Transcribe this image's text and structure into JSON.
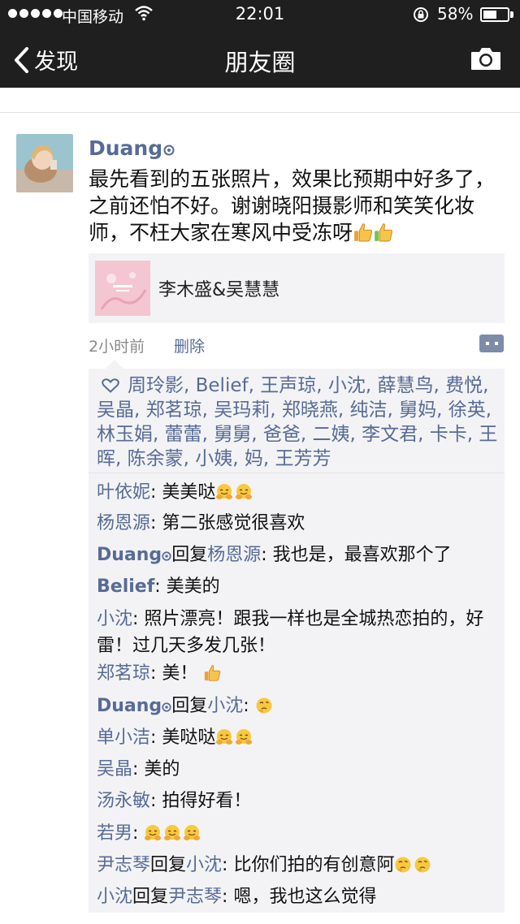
{
  "status_bar": {
    "carrier": "中国移动",
    "time": "22:01",
    "battery_percent_text": "58%",
    "battery_level": 0.58
  },
  "nav": {
    "back_label": "发现",
    "title": "朋友圈",
    "camera_icon": "camera-icon"
  },
  "post": {
    "author": "Duang",
    "text": "最先看到的五张照片，效果比预期中好多了，之前还怕不好。谢谢晓阳摄影师和笑笑化妆师，不枉大家在寒风中受冻呀",
    "link_title": "李木盛&吴慧慧",
    "time": "2小时前",
    "delete_label": "删除"
  },
  "likes": "周玲影, Belief, 王声琼, 小沈, 薛慧鸟, 费悦, 吴晶, 郑茗琼, 吴玛莉, 郑晓燕, 纯洁, 舅妈, 徐英, 林玉娟, 蕾蕾, 舅舅, 爸爸, 二姨, 李文君, 卡卡, 王晖, 陈余蒙, 小姨, 妈, 王芳芳",
  "comments": [
    {
      "author": "叶依妮",
      "text": "美美哒"
    },
    {
      "author": "杨恩源",
      "text": "第二张感觉很喜欢"
    },
    {
      "author": "Duang",
      "reply_word": "回复",
      "reply_to": "杨恩源",
      "text": "我也是，最喜欢那个了"
    },
    {
      "author": "Belief",
      "text": "美美的"
    },
    {
      "author": "小沈",
      "text": "照片漂亮！跟我一样也是全城热恋拍的，好雷！过几天多发几张！"
    },
    {
      "author": "郑茗琼",
      "text": "美！"
    },
    {
      "author": "Duang",
      "reply_word": "回复",
      "reply_to": "小沈",
      "text": ""
    },
    {
      "author": "单小洁",
      "text": "美哒哒"
    },
    {
      "author": "吴晶",
      "text": "美的"
    },
    {
      "author": "汤永敏",
      "text": "拍得好看！"
    },
    {
      "author": "若男",
      "text": ""
    },
    {
      "author": "尹志琴",
      "reply_word": "回复",
      "reply_to": "小沈",
      "text": "比你们拍的有创意阿"
    },
    {
      "author": "小沈",
      "reply_word": "回复",
      "reply_to": "尹志琴",
      "text": "嗯，我也这么觉得"
    }
  ],
  "colors": {
    "topbar": "#1f1f20",
    "link_blue": "#576b95",
    "comment_bg": "#f3f3f5"
  }
}
